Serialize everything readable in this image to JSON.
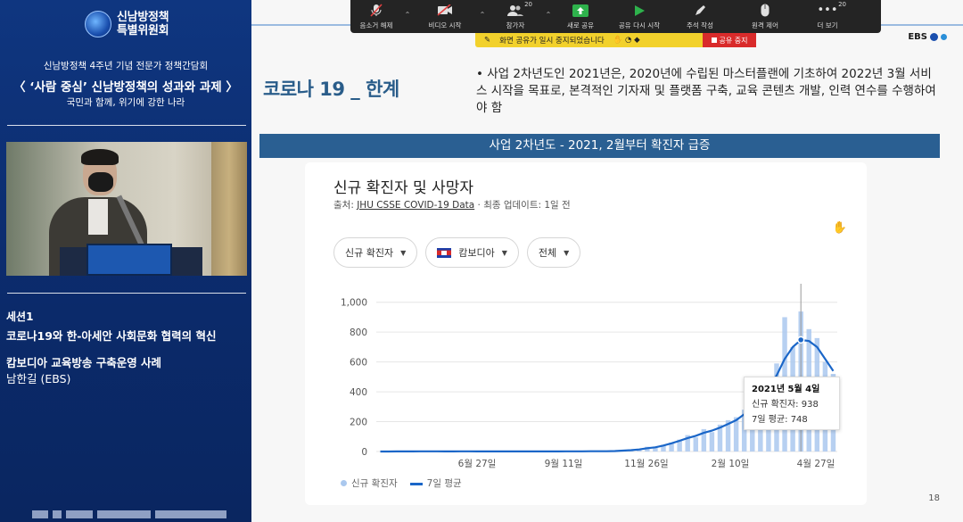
{
  "left": {
    "org": [
      "신남방정책",
      "특별위원회"
    ],
    "event_line1": "신남방정책 4주년 기념 전문가 정책간담회",
    "event_line2": "〈 ‘사람 중심’ 신남방정책의 성과와 과제 〉",
    "event_line3": "국민과 함께, 위기에 강한 나라",
    "session": "세션1",
    "session_title": "코로나19와 한-아세안 사회문화 협력의 혁신",
    "case_title": "캄보디아 교육방송 구축운영 사례",
    "speaker": "남한길 (EBS)"
  },
  "zoom": {
    "buttons": [
      {
        "name": "unmute",
        "label": "음소거 해제",
        "icon": "mic-off-icon"
      },
      {
        "name": "video",
        "label": "비디오 시작",
        "icon": "video-off-icon"
      },
      {
        "name": "participants",
        "label": "참가자",
        "icon": "participants-icon",
        "count": "20"
      },
      {
        "name": "new-share",
        "label": "새로 공유",
        "icon": "share-icon"
      },
      {
        "name": "resume-share",
        "label": "공유 다시 시작",
        "icon": "play-icon"
      },
      {
        "name": "annotate",
        "label": "주석 작성",
        "icon": "pen-icon"
      },
      {
        "name": "remote-control",
        "label": "원격 제어",
        "icon": "mouse-icon"
      },
      {
        "name": "more",
        "label": "더 보기",
        "icon": "more-icon",
        "count": "20"
      }
    ],
    "pause_text": "화면 공유가 일시 중지되었습니다",
    "stop_label": "공유 중지"
  },
  "slide": {
    "title": "코로나 19 _ 한계",
    "bullet": "• 사업 2차년도인 2021년은, 2020년에 수립된 마스터플랜에 기초하여 2022년 3월 서비스 시작을 목표로, 본격적인 기자재 및 플랫폼 구축, 교육 콘텐츠 개발, 인력 연수를 수행하여야 함",
    "banner": "사업 2차년도 - 2021, 2월부터 확진자 급증",
    "page": "18",
    "brand": "EBS"
  },
  "card": {
    "title": "신규 확진자 및 사망자",
    "source_prefix": "출처: ",
    "source_link": "JHU CSSE COVID-19 Data",
    "source_suffix": " · 최종 업데이트: 1일 전",
    "chips": [
      {
        "label": "신규 확진자",
        "flag": false
      },
      {
        "label": "캄보디아",
        "flag": true
      },
      {
        "label": "전체",
        "flag": false
      }
    ],
    "tooltip": {
      "date": "2021년 5월 4일",
      "line1": "신규 확진자: 938",
      "line2": "7일 평균: 748"
    },
    "legend": {
      "bars": "신규 확진자",
      "line": "7일 평균"
    }
  },
  "chart_data": {
    "type": "bar",
    "title": "신규 확진자 및 사망자",
    "y_ticks": [
      "0",
      "200",
      "400",
      "600",
      "800",
      "1,000"
    ],
    "ylim": [
      0,
      1100
    ],
    "x_ticks": [
      "6월 27일",
      "9월 11일",
      "11월 26일",
      "2월 10일",
      "4월 27일"
    ],
    "series": [
      {
        "name": "신규 확진자",
        "kind": "bar",
        "color": "#aac8ee",
        "values": [
          0,
          0,
          1,
          0,
          0,
          2,
          0,
          1,
          0,
          0,
          3,
          0,
          0,
          1,
          0,
          0,
          2,
          0,
          0,
          1,
          0,
          0,
          0,
          2,
          1,
          0,
          4,
          2,
          1,
          3,
          6,
          10,
          15,
          32,
          25,
          45,
          60,
          80,
          110,
          95,
          150,
          130,
          180,
          210,
          230,
          280,
          380,
          310,
          470,
          590,
          900,
          700,
          938,
          820,
          760,
          600,
          520
        ]
      },
      {
        "name": "7일 평균",
        "kind": "line",
        "color": "#1a66c8",
        "values": [
          0,
          0,
          0.5,
          0.5,
          0.5,
          1,
          1,
          1,
          0.5,
          0.5,
          1,
          1,
          0.8,
          0.8,
          0.6,
          0.6,
          1,
          0.8,
          0.6,
          0.5,
          0.5,
          0.5,
          0.7,
          1,
          1,
          1,
          2,
          2,
          2,
          3,
          6,
          9,
          14,
          22,
          28,
          40,
          55,
          72,
          90,
          105,
          125,
          140,
          160,
          185,
          210,
          250,
          300,
          350,
          420,
          510,
          620,
          700,
          748,
          740,
          700,
          620,
          540
        ]
      }
    ],
    "grid": true
  }
}
